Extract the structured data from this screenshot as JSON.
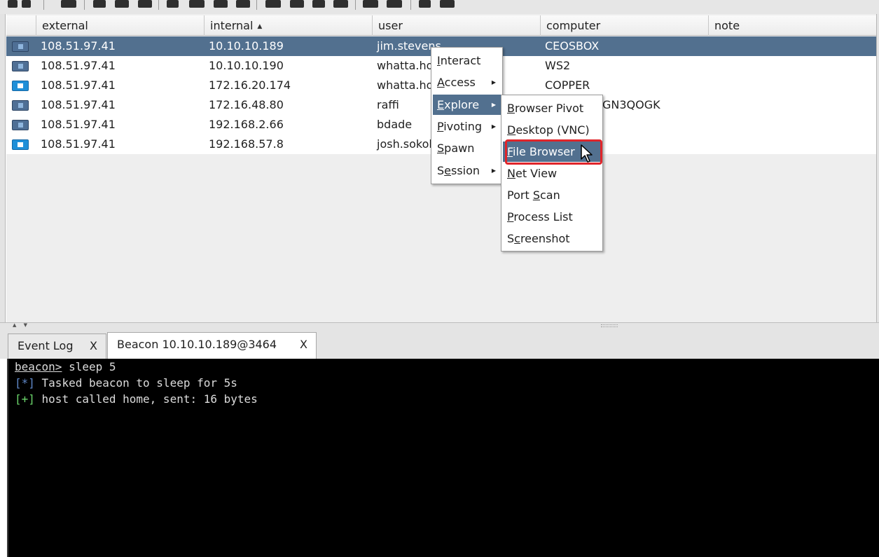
{
  "table": {
    "columns": [
      {
        "key": "icon",
        "label": ""
      },
      {
        "key": "external",
        "label": "external"
      },
      {
        "key": "internal",
        "label": "internal"
      },
      {
        "key": "user",
        "label": "user"
      },
      {
        "key": "computer",
        "label": "computer"
      },
      {
        "key": "note",
        "label": "note"
      }
    ],
    "sort_indicator": "▲",
    "rows": [
      {
        "icon": "linux-monitor-icon",
        "external": "108.51.97.41",
        "internal": "10.10.10.189",
        "user": "jim.stevens",
        "computer": "CEOSBOX",
        "note": "",
        "selected": true
      },
      {
        "icon": "linux-monitor-icon",
        "external": "108.51.97.41",
        "internal": "10.10.10.190",
        "user": "whatta.hogg",
        "computer": "WS2",
        "note": "",
        "selected": false
      },
      {
        "icon": "windows-monitor-icon",
        "external": "108.51.97.41",
        "internal": "172.16.20.174",
        "user": "whatta.hogg",
        "computer": "COPPER",
        "note": "",
        "selected": false
      },
      {
        "icon": "linux-monitor-icon",
        "external": "108.51.97.41",
        "internal": "172.16.48.80",
        "user": "raffi",
        "computer": "GN3QOGK",
        "note": "",
        "selected": false
      },
      {
        "icon": "linux-monitor-icon",
        "external": "108.51.97.41",
        "internal": "192.168.2.66",
        "user": "bdade",
        "computer": "",
        "note": "",
        "selected": false
      },
      {
        "icon": "windows-monitor-icon",
        "external": "108.51.97.41",
        "internal": "192.168.57.8",
        "user": "josh.sokol",
        "computer": "",
        "note": "",
        "selected": false
      }
    ]
  },
  "context_menu": {
    "items": [
      {
        "label": "Interact",
        "mnemonic_index": 0,
        "submenu": false
      },
      {
        "label": "Access",
        "mnemonic_index": 0,
        "submenu": true
      },
      {
        "label": "Explore",
        "mnemonic_index": 0,
        "submenu": true,
        "highlighted": true
      },
      {
        "label": "Pivoting",
        "mnemonic_index": 0,
        "submenu": true
      },
      {
        "label": "Spawn",
        "mnemonic_index": 0,
        "submenu": false
      },
      {
        "label": "Session",
        "mnemonic_index": 1,
        "submenu": true
      }
    ],
    "submenu_arrow": "▶"
  },
  "explore_menu": {
    "items": [
      {
        "label": "Browser Pivot",
        "mnemonic_index": 0
      },
      {
        "label": "Desktop (VNC)",
        "mnemonic_index": 0
      },
      {
        "label": "File Browser",
        "mnemonic_index": 0,
        "highlighted": true
      },
      {
        "label": "Net View",
        "mnemonic_index": 0
      },
      {
        "label": "Port Scan",
        "mnemonic_index": 5
      },
      {
        "label": "Process List",
        "mnemonic_index": 0
      },
      {
        "label": "Screenshot",
        "mnemonic_index": 1
      }
    ]
  },
  "splitter": {
    "arrows": "▲ ▼"
  },
  "tabs": [
    {
      "label": "Event Log",
      "close": "X",
      "active": false
    },
    {
      "label": "Beacon 10.10.10.189@3464",
      "close": "X",
      "active": true
    }
  ],
  "console": {
    "prompt": "beacon>",
    "command": " sleep 5",
    "lines": [
      {
        "tag": "[*]",
        "text": " Tasked beacon to sleep for 5s"
      },
      {
        "tag": "[+]",
        "text": " host called home, sent: 16 bytes"
      }
    ]
  },
  "colors": {
    "selection": "#52708f",
    "highlight_outline": "#e0252a",
    "console_bg": "#000000",
    "info_tag": "#5f88c9",
    "success_tag": "#6bd66b"
  }
}
